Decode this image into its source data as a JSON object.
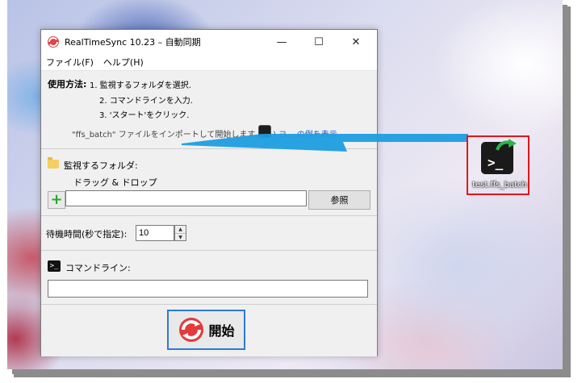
{
  "window": {
    "title": "RealTimeSync 10.23 – 自動同期",
    "controls": {
      "minimize": "—",
      "maximize": "☐",
      "close": "✕"
    }
  },
  "menu": {
    "file": "ファイル(F)",
    "help": "ヘルプ(H)"
  },
  "usage": {
    "label": "使用方法:",
    "steps": [
      "1. 監視するフォルダを選択.",
      "2. コマンドラインを入力.",
      "3. 'スタート'をクリック."
    ],
    "note": "\"ffs_batch\" ファイルをインポートして開始します. (",
    "show_example": ") ヨ ...の例を表示"
  },
  "folder": {
    "label": "監視するフォルダ:",
    "dnd_hint": "ドラッグ & ドロップ",
    "path_value": "",
    "browse_label": "参照"
  },
  "wait": {
    "label": "待機時間(秒で指定):",
    "value": "10"
  },
  "command": {
    "label": "コマンドライン:",
    "value": ""
  },
  "start": {
    "label": "開始"
  },
  "desktop": {
    "shortcut_label": "test.ffs_batch"
  },
  "colors": {
    "accent_blue": "#2b7ad6",
    "highlight_red": "#e2161b",
    "arrow_blue": "#1e9de0"
  }
}
